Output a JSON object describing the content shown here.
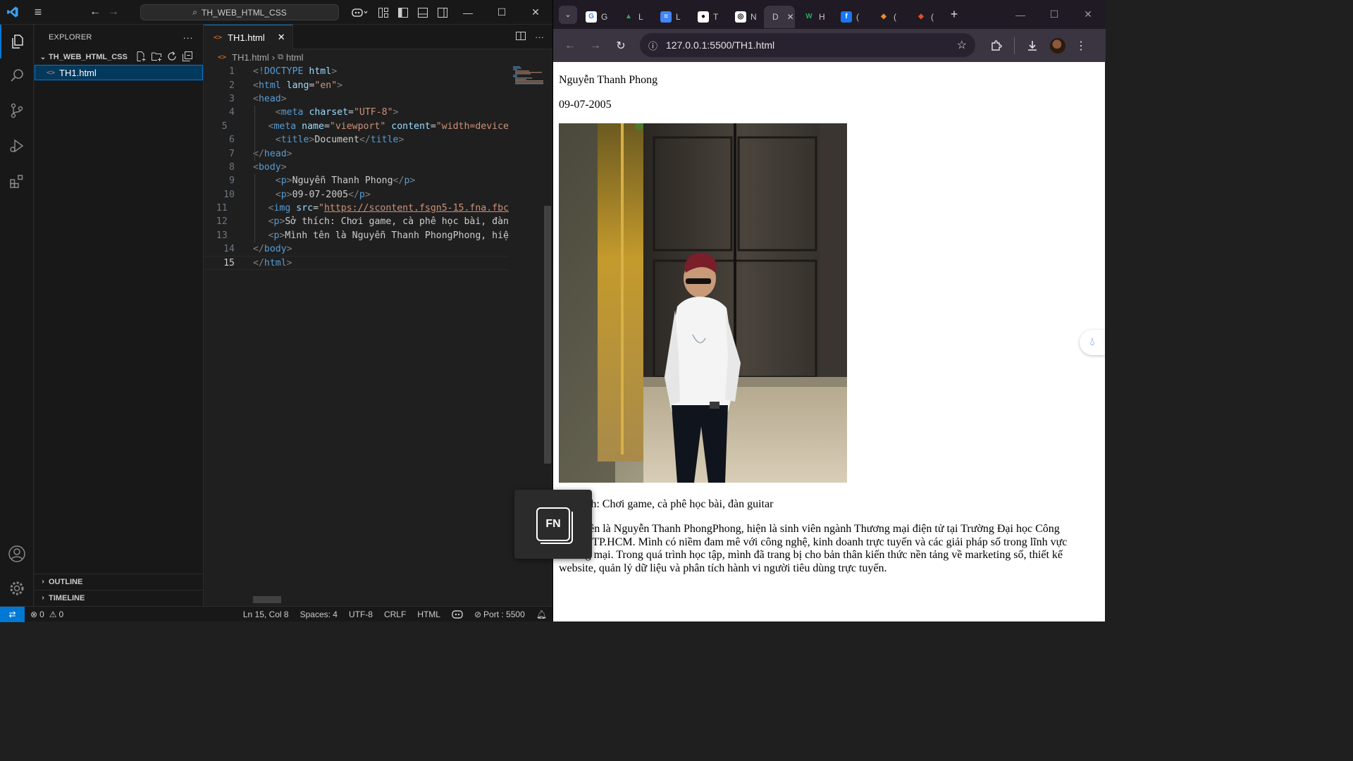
{
  "vscode": {
    "search_title": "TH_WEB_HTML_CSS",
    "explorer": {
      "header": "EXPLORER",
      "folder": "TH_WEB_HTML_CSS",
      "files": [
        "TH1.html"
      ],
      "sections": [
        "OUTLINE",
        "TIMELINE"
      ]
    },
    "tab": {
      "label": "TH1.html"
    },
    "breadcrumb": {
      "file": "TH1.html",
      "symbol": "html"
    },
    "code_lines": [
      {
        "n": "1",
        "parts": [
          [
            "punc",
            "<!"
          ],
          [
            "tag",
            "DOCTYPE"
          ],
          [
            "text",
            " "
          ],
          [
            "attr",
            "html"
          ],
          [
            "punc",
            ">"
          ]
        ]
      },
      {
        "n": "2",
        "parts": [
          [
            "punc",
            "<"
          ],
          [
            "tag",
            "html"
          ],
          [
            "text",
            " "
          ],
          [
            "attr",
            "lang"
          ],
          [
            "text",
            "="
          ],
          [
            "str",
            "\"en\""
          ],
          [
            "punc",
            ">"
          ]
        ]
      },
      {
        "n": "3",
        "parts": [
          [
            "punc",
            "<"
          ],
          [
            "tag",
            "head"
          ],
          [
            "punc",
            ">"
          ]
        ]
      },
      {
        "n": "4",
        "parts": [
          [
            "text",
            "    "
          ],
          [
            "punc",
            "<"
          ],
          [
            "tag",
            "meta"
          ],
          [
            "text",
            " "
          ],
          [
            "attr",
            "charset"
          ],
          [
            "text",
            "="
          ],
          [
            "str",
            "\"UTF-8\""
          ],
          [
            "punc",
            ">"
          ]
        ]
      },
      {
        "n": "5",
        "parts": [
          [
            "text",
            "    "
          ],
          [
            "punc",
            "<"
          ],
          [
            "tag",
            "meta"
          ],
          [
            "text",
            " "
          ],
          [
            "attr",
            "name"
          ],
          [
            "text",
            "="
          ],
          [
            "str",
            "\"viewport\""
          ],
          [
            "text",
            " "
          ],
          [
            "attr",
            "content"
          ],
          [
            "text",
            "="
          ],
          [
            "str",
            "\"width=device"
          ]
        ]
      },
      {
        "n": "6",
        "parts": [
          [
            "text",
            "    "
          ],
          [
            "punc",
            "<"
          ],
          [
            "tag",
            "title"
          ],
          [
            "punc",
            ">"
          ],
          [
            "text",
            "Document"
          ],
          [
            "punc",
            "</"
          ],
          [
            "tag",
            "title"
          ],
          [
            "punc",
            ">"
          ]
        ]
      },
      {
        "n": "7",
        "parts": [
          [
            "punc",
            "</"
          ],
          [
            "tag",
            "head"
          ],
          [
            "punc",
            ">"
          ]
        ]
      },
      {
        "n": "8",
        "parts": [
          [
            "punc",
            "<"
          ],
          [
            "tag",
            "body"
          ],
          [
            "punc",
            ">"
          ]
        ]
      },
      {
        "n": "9",
        "parts": [
          [
            "text",
            "    "
          ],
          [
            "punc",
            "<"
          ],
          [
            "tag",
            "p"
          ],
          [
            "punc",
            ">"
          ],
          [
            "text",
            "Nguyễn Thanh Phong"
          ],
          [
            "punc",
            "</"
          ],
          [
            "tag",
            "p"
          ],
          [
            "punc",
            ">"
          ]
        ]
      },
      {
        "n": "10",
        "parts": [
          [
            "text",
            "    "
          ],
          [
            "punc",
            "<"
          ],
          [
            "tag",
            "p"
          ],
          [
            "punc",
            ">"
          ],
          [
            "text",
            "09-07-2005"
          ],
          [
            "punc",
            "</"
          ],
          [
            "tag",
            "p"
          ],
          [
            "punc",
            ">"
          ]
        ]
      },
      {
        "n": "11",
        "parts": [
          [
            "text",
            "    "
          ],
          [
            "punc",
            "<"
          ],
          [
            "tag",
            "img"
          ],
          [
            "text",
            " "
          ],
          [
            "attr",
            "src"
          ],
          [
            "text",
            "="
          ],
          [
            "str",
            "\""
          ],
          [
            "link",
            "https://scontent.fsgn5-15.fna.fbc"
          ]
        ]
      },
      {
        "n": "12",
        "parts": [
          [
            "text",
            "    "
          ],
          [
            "punc",
            "<"
          ],
          [
            "tag",
            "p"
          ],
          [
            "punc",
            ">"
          ],
          [
            "text",
            "Sở thích: Chơi game, cà phê học bài, đàn"
          ]
        ]
      },
      {
        "n": "13",
        "parts": [
          [
            "text",
            "    "
          ],
          [
            "punc",
            "<"
          ],
          [
            "tag",
            "p"
          ],
          [
            "punc",
            ">"
          ],
          [
            "text",
            "Mình tên là Nguyễn Thanh PhongPhong, hiệ"
          ]
        ]
      },
      {
        "n": "14",
        "parts": [
          [
            "punc",
            "</"
          ],
          [
            "tag",
            "body"
          ],
          [
            "punc",
            ">"
          ]
        ]
      },
      {
        "n": "15",
        "parts": [
          [
            "punc",
            "</"
          ],
          [
            "tag",
            "html"
          ],
          [
            "punc",
            ">"
          ]
        ]
      }
    ],
    "current_line": "15",
    "status": {
      "errors": "0",
      "warnings": "0",
      "position": "Ln 15, Col 8",
      "spaces": "Spaces: 4",
      "encoding": "UTF-8",
      "eol": "CRLF",
      "language": "HTML",
      "port": "Port : 5500"
    },
    "fn_overlay": "FN"
  },
  "chrome": {
    "tabs": [
      {
        "fav": "G",
        "color": "#ffffff",
        "fg": "#4285f4",
        "label": "G"
      },
      {
        "fav": "▲",
        "color": "transparent",
        "fg": "#34a853",
        "label": "L"
      },
      {
        "fav": "≡",
        "color": "#4285f4",
        "fg": "#ffffff",
        "label": "L"
      },
      {
        "fav": "●",
        "color": "#ffffff",
        "fg": "#000000",
        "label": "T"
      },
      {
        "fav": "◎",
        "color": "#ffffff",
        "fg": "#000000",
        "label": "N"
      },
      {
        "fav": "",
        "color": "transparent",
        "fg": "#ffffff",
        "label": "D",
        "active": true
      },
      {
        "fav": "W",
        "color": "transparent",
        "fg": "#1faf5a",
        "label": "H"
      },
      {
        "fav": "f",
        "color": "#1877f2",
        "fg": "#ffffff",
        "label": "("
      },
      {
        "fav": "◆",
        "color": "transparent",
        "fg": "#f08a24",
        "label": "("
      },
      {
        "fav": "◆",
        "color": "transparent",
        "fg": "#e44d26",
        "label": "("
      }
    ],
    "url": "127.0.0.1:5500/TH1.html",
    "page": {
      "name": "Nguyễn Thanh Phong",
      "dob": "09-07-2005",
      "hobbies": "Sở thích: Chơi game, cà phê học bài, đàn guitar",
      "bio": "Mình tên là Nguyễn Thanh PhongPhong, hiện là sinh viên ngành Thương mại điện tử tại Trường Đại học Công nghiệp TP.HCM. Mình có niềm đam mê với công nghệ, kinh doanh trực tuyến và các giải pháp số trong lĩnh vực thương mại. Trong quá trình học tập, mình đã trang bị cho bản thân kiến thức nền tảng về marketing số, thiết kế website, quản lý dữ liệu và phân tích hành vi người tiêu dùng trực tuyến."
    }
  },
  "colors": {
    "accent": "#0078d4",
    "tag": "#569cd6",
    "attr": "#9cdcfe",
    "string": "#ce9178",
    "chrome_frame": "#1f1a24",
    "chrome_toolbar": "#3b3441"
  }
}
